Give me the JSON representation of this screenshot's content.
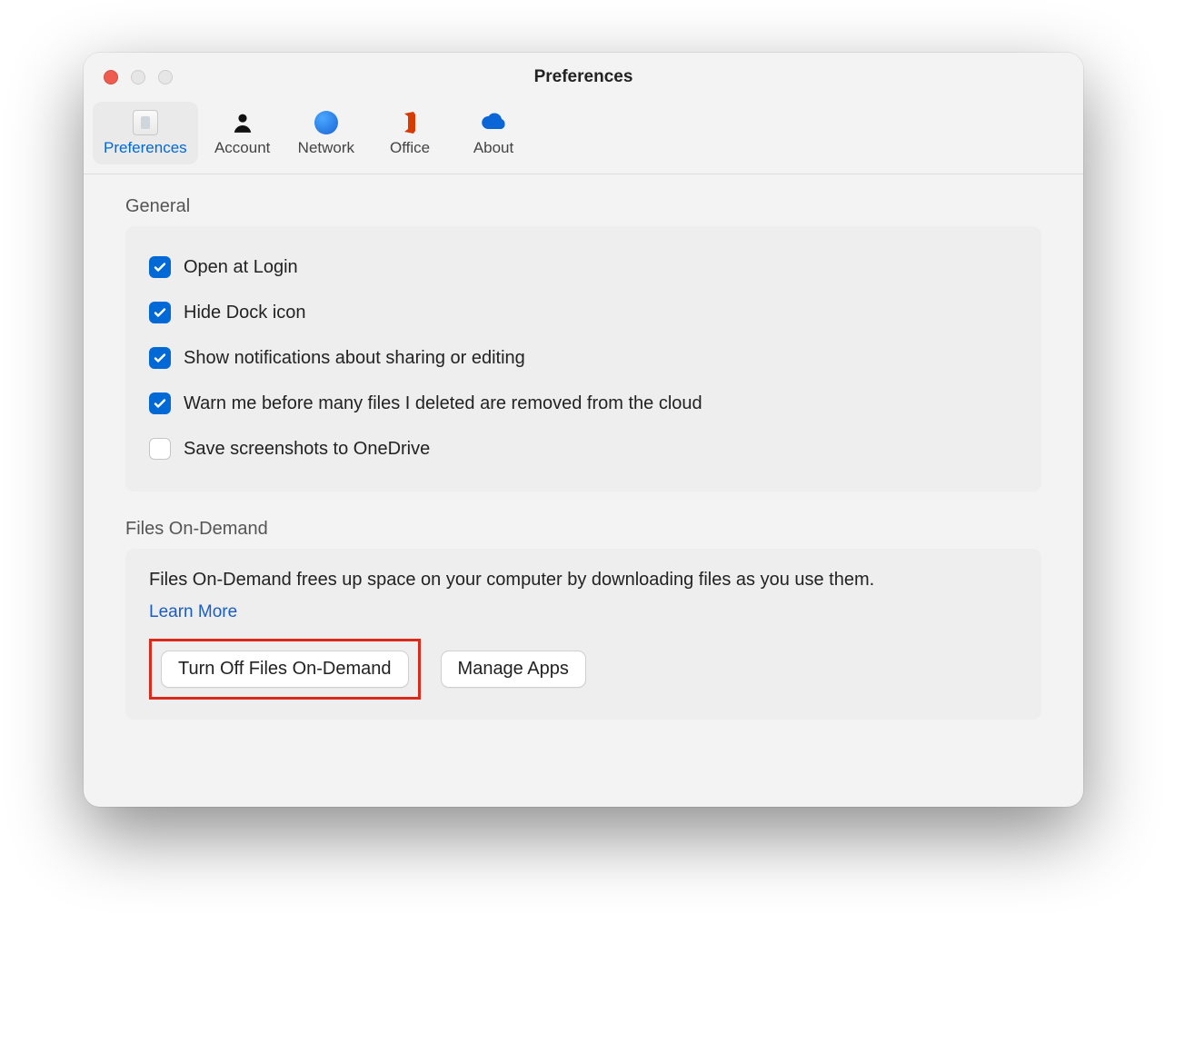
{
  "window": {
    "title": "Preferences"
  },
  "toolbar": {
    "tabs": [
      {
        "label": "Preferences",
        "icon": "preferences-icon",
        "selected": true
      },
      {
        "label": "Account",
        "icon": "account-icon",
        "selected": false
      },
      {
        "label": "Network",
        "icon": "network-icon",
        "selected": false
      },
      {
        "label": "Office",
        "icon": "office-icon",
        "selected": false
      },
      {
        "label": "About",
        "icon": "about-icon",
        "selected": false
      }
    ]
  },
  "sections": {
    "general": {
      "title": "General",
      "items": [
        {
          "label": "Open at Login",
          "checked": true
        },
        {
          "label": "Hide Dock icon",
          "checked": true
        },
        {
          "label": "Show notifications about sharing or editing",
          "checked": true
        },
        {
          "label": "Warn me before many files I deleted are removed from the cloud",
          "checked": true
        },
        {
          "label": "Save screenshots to OneDrive",
          "checked": false
        }
      ]
    },
    "filesOnDemand": {
      "title": "Files On-Demand",
      "description": "Files On-Demand frees up space on your computer by downloading files as you use them.",
      "learn_more": "Learn More",
      "turn_off_button": "Turn Off Files On-Demand",
      "manage_apps_button": "Manage Apps"
    }
  },
  "annotation": {
    "highlight_target": "turn-off-files-on-demand-button"
  }
}
